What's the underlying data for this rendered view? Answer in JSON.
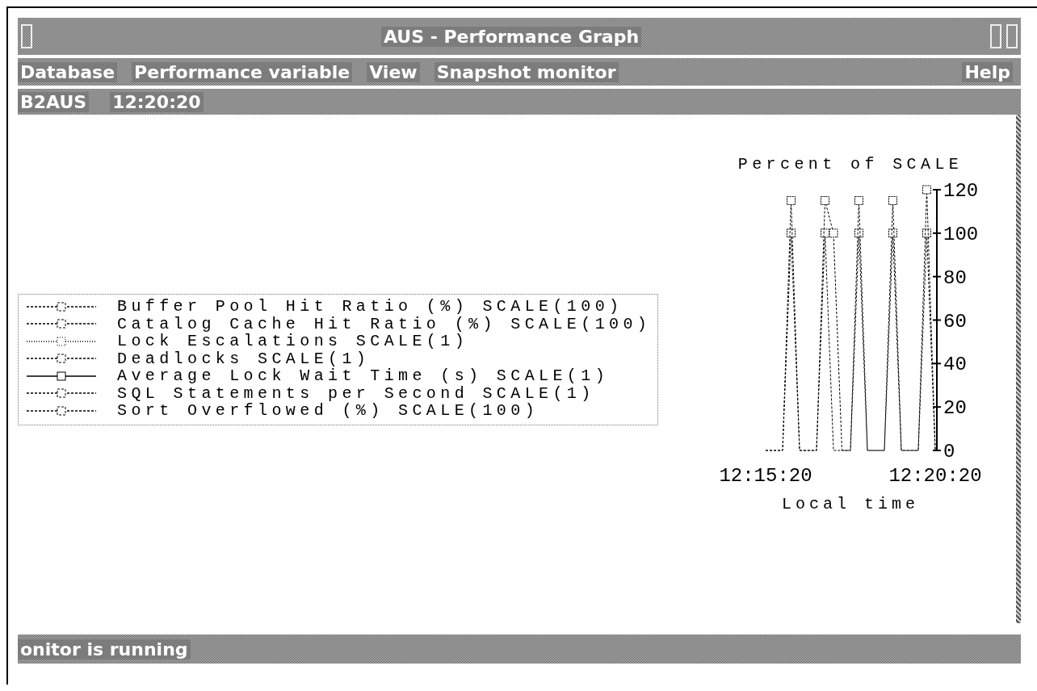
{
  "window": {
    "title": "AUS - Performance Graph"
  },
  "menu": [
    {
      "label": "Database"
    },
    {
      "label": "Performance variable"
    },
    {
      "label": "View"
    },
    {
      "label": "Snapshot monitor"
    },
    {
      "label": "Help"
    }
  ],
  "info_bar": {
    "database": "B2AUS",
    "time": "12:20:20"
  },
  "chart_data": {
    "type": "line",
    "title": "Percent of SCALE",
    "xlabel": "Local time",
    "categories": [
      "12:15:20",
      null,
      null,
      null,
      null,
      null,
      null,
      null,
      null,
      null,
      null,
      null,
      null,
      null,
      null,
      null,
      null,
      null,
      null,
      null,
      "12:20:20"
    ],
    "ylim": [
      0,
      120
    ],
    "yticks": [
      0,
      20,
      40,
      60,
      80,
      100,
      120
    ],
    "series": [
      {
        "name": "Buffer Pool Hit Ratio (%) SCALE(100)",
        "line_style": "dashed",
        "values": [
          0,
          0,
          0,
          100,
          0,
          0,
          0,
          100,
          0,
          0,
          0,
          100,
          0,
          0,
          0,
          100,
          0,
          0,
          0,
          100,
          0
        ]
      },
      {
        "name": "Catalog Cache Hit Ratio (%) SCALE(100)",
        "line_style": "dashed",
        "values": [
          0,
          0,
          0,
          115,
          0,
          0,
          0,
          115,
          100,
          0,
          0,
          115,
          0,
          0,
          0,
          115,
          0,
          0,
          0,
          120,
          0
        ]
      },
      {
        "name": "Lock Escalations SCALE(1)",
        "line_style": "dotted",
        "values": [
          null,
          null,
          null,
          null,
          null,
          null,
          null,
          null,
          null,
          null,
          null,
          null,
          null,
          null,
          null,
          null,
          null,
          null,
          null,
          null,
          null
        ]
      },
      {
        "name": "Deadlocks SCALE(1)",
        "line_style": "dashed",
        "values": [
          null,
          null,
          null,
          null,
          null,
          null,
          null,
          null,
          null,
          null,
          null,
          null,
          null,
          null,
          null,
          null,
          null,
          null,
          null,
          null,
          null
        ]
      },
      {
        "name": "Average Lock Wait Time (s) SCALE(1)",
        "line_style": "solid",
        "values": [
          null,
          null,
          null,
          null,
          null,
          null,
          null,
          null,
          null,
          null,
          null,
          null,
          null,
          null,
          null,
          null,
          null,
          null,
          null,
          null,
          null
        ]
      },
      {
        "name": "SQL Statements per Second SCALE(1)",
        "line_style": "dashed",
        "values": [
          null,
          null,
          null,
          null,
          null,
          null,
          null,
          null,
          null,
          null,
          null,
          null,
          null,
          null,
          null,
          null,
          null,
          null,
          null,
          null,
          null
        ]
      },
      {
        "name": "Sort Overflowed (%) SCALE(100)",
        "line_style": "dashed",
        "values": [
          null,
          null,
          null,
          null,
          null,
          null,
          null,
          null,
          null,
          null,
          null,
          null,
          null,
          null,
          null,
          null,
          null,
          null,
          null,
          null,
          null
        ]
      }
    ]
  },
  "status_bar": {
    "text": "onitor is running"
  }
}
